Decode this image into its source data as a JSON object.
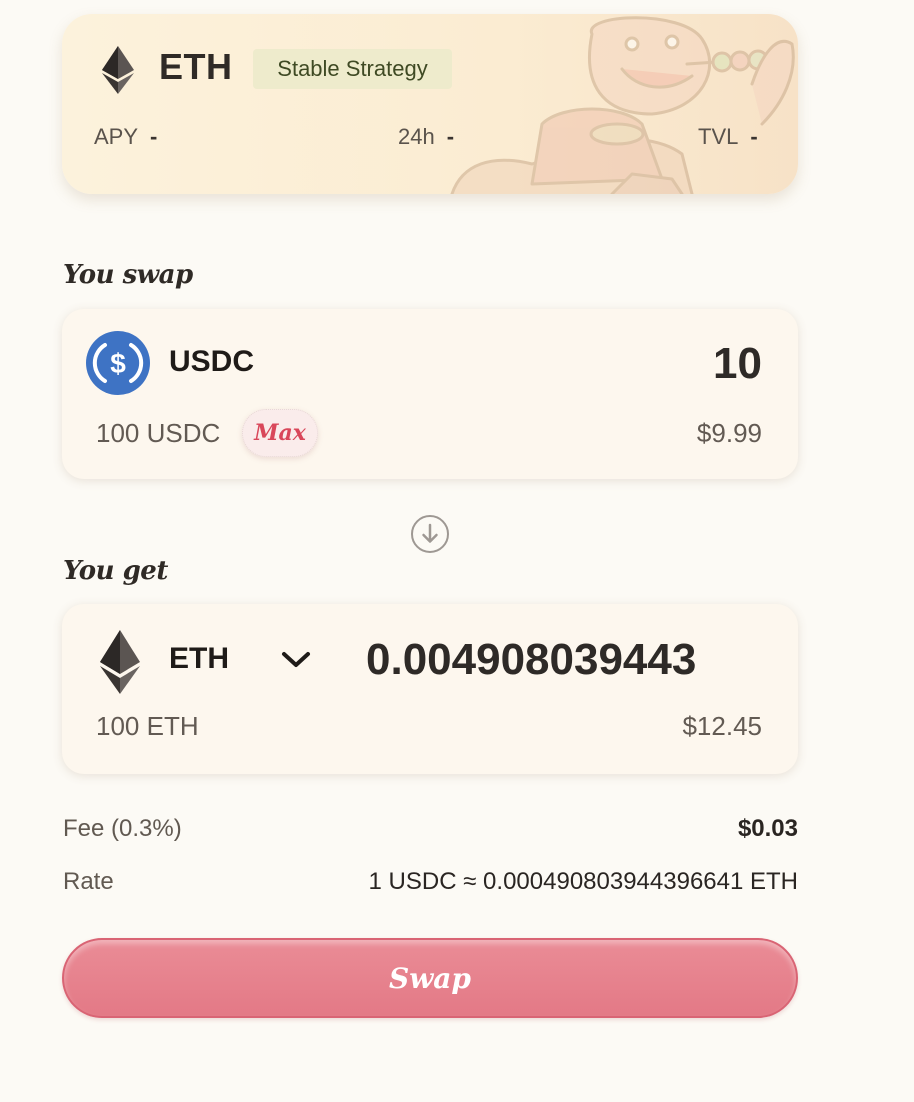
{
  "strategy_card": {
    "token": "ETH",
    "badge": "Stable Strategy",
    "stats": [
      {
        "label": "APY",
        "value": "-"
      },
      {
        "label": "24h",
        "value": "-"
      },
      {
        "label": "TVL",
        "value": "-"
      }
    ]
  },
  "from_section": {
    "title": "You swap",
    "token": "USDC",
    "amount": "10",
    "balance": "100 USDC",
    "max_label": "Max",
    "usd_value": "$9.99"
  },
  "to_section": {
    "title": "You get",
    "token": "ETH",
    "amount": "0.004908039443",
    "balance": "100 ETH",
    "usd_value": "$12.45"
  },
  "details": {
    "fee_label": "Fee (0.3%)",
    "fee_value": "$0.03",
    "rate_label": "Rate",
    "rate_value": "1 USDC ≈ 0.000490803944396641 ETH"
  },
  "swap_button": "Swap",
  "colors": {
    "accent": "#e37986",
    "usdc_blue": "#3e73c4",
    "badge_bg": "#eeebcc",
    "max_text": "#d9475a"
  },
  "icons": {
    "strategy_token": "ethereum-icon",
    "from_token": "usdc-icon",
    "to_token": "ethereum-icon",
    "direction": "arrow-down-circle-icon",
    "token_select": "chevron-down-icon"
  }
}
